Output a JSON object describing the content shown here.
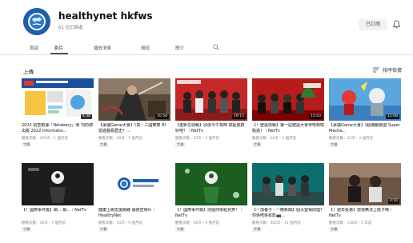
{
  "channel": {
    "name": "healthynet hkfws",
    "subscribers": "61 位訂閱者",
    "subscribed_label": "已訂閱",
    "accent_color": "#1f5fae"
  },
  "tabs": [
    {
      "label": "首頁"
    },
    {
      "label": "影片"
    },
    {
      "label": "播放清單"
    },
    {
      "label": "頻道"
    },
    {
      "label": "簡介"
    }
  ],
  "section": {
    "title": "上傳",
    "sort_label": "排序依據"
  },
  "videos": [
    {
      "title": "2022 調查數據「Netabery」明 刊的總出版 2022 Informatio...",
      "meta": "觀看次數：296次・1 個月前",
      "duration": "4:38",
      "cc": "字幕",
      "thumb_icon": "survey-thumbnail"
    },
    {
      "title": "【爭議Game大會】《真・三國無雙 8》從遊戲看歷史？...",
      "meta": "觀看次數：49次・1 個月前",
      "duration": "10:58",
      "cc": "字幕",
      "thumb_icon": "game-warrior-thumbnail"
    },
    {
      "title": "【重新在快戰】別低今午有時 搞起成群好吧？｜NetTv",
      "meta": "觀看次數：53次・3 個月前",
      "duration": "19:15",
      "cc": "字幕",
      "thumb_icon": "group-masks-thumbnail"
    },
    {
      "title": "【！聖誕快戰】第一屆聖誕大會學唔到咁點過！｜NetTv",
      "meta": "觀看次數：56次・3 個月前",
      "duration": "15:03",
      "cc": "字幕",
      "thumb_icon": "christmas-thumbnail"
    },
    {
      "title": "【爭議Game大會】《超機動聯盟 Super Mecha...",
      "meta": "觀看次數：21次・3 個月前",
      "duration": "12:08",
      "cc": "字幕",
      "thumb_icon": "mecha-game-thumbnail"
    },
    {
      "title": "【！國際事件篇】網... 網...｜NetTv",
      "meta": "觀看次數：40次・7 個月前",
      "duration": "",
      "cc": "字幕",
      "thumb_icon": "dark-avatar-thumbnail"
    },
    {
      "title": "健康上網支援網絡 服務宣傳片｜HealthyNet",
      "meta": "觀看次數：10次・9 個月前",
      "duration": "",
      "cc": "字幕",
      "thumb_icon": "healthynet-logo-thumbnail"
    },
    {
      "title": "【！國際事件篇】別提你係點見笑！｜NetTv",
      "meta": "觀看次數：56次・9 個月前",
      "duration": "",
      "cc": "字幕",
      "thumb_icon": "green-avatar-thumbnail"
    },
    {
      "title": "【一加養子・一晚新聞】個大室相問理？你係唔係有影📷...",
      "meta": "觀看次數：402次・11 個月前",
      "duration": "",
      "cc": "字幕",
      "thumb_icon": "classroom-thumbnail"
    },
    {
      "title": "【！遊年投選】當我無法上班子嗎｜NetTv",
      "meta": "觀看次數：139次・1 年前",
      "duration": "4:50",
      "cc": "字幕",
      "thumb_icon": "two-people-thumbnail"
    }
  ]
}
